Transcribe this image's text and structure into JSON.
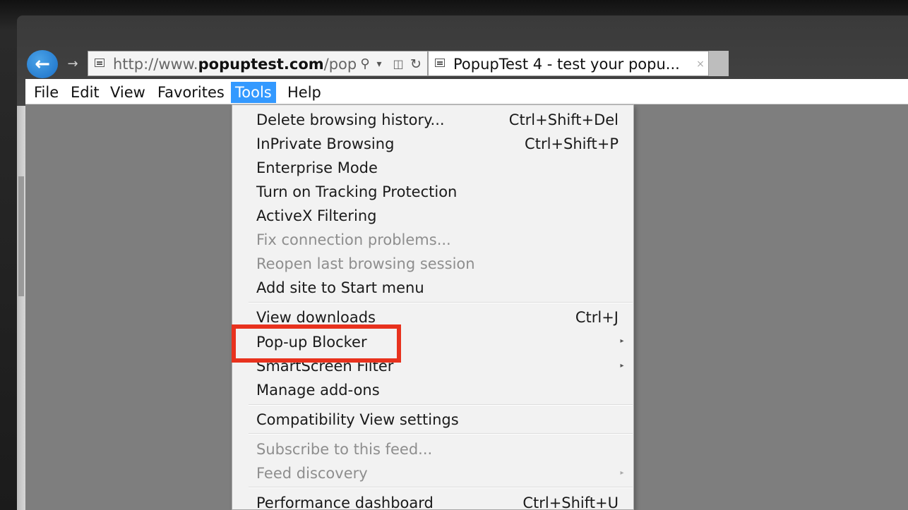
{
  "browser": {
    "address": {
      "prefix": "http://www.",
      "domain": "popuptest.com",
      "suffix": "/popu",
      "search_icon": "search-icon",
      "refresh_icon": "refresh-icon"
    },
    "tab": {
      "title": "PopupTest 4 - test your popu...",
      "close_symbol": "×"
    }
  },
  "menubar": {
    "items": [
      "File",
      "Edit",
      "View",
      "Favorites",
      "Tools",
      "Help"
    ],
    "active": "Tools"
  },
  "tools_menu": {
    "items": [
      {
        "label": "Delete browsing history...",
        "shortcut": "Ctrl+Shift+Del",
        "enabled": true
      },
      {
        "label": "InPrivate Browsing",
        "shortcut": "Ctrl+Shift+P",
        "enabled": true
      },
      {
        "label": "Enterprise Mode",
        "shortcut": "",
        "enabled": true
      },
      {
        "label": "Turn on Tracking Protection",
        "shortcut": "",
        "enabled": true
      },
      {
        "label": "ActiveX Filtering",
        "shortcut": "",
        "enabled": true
      },
      {
        "label": "Fix connection problems...",
        "shortcut": "",
        "enabled": false
      },
      {
        "label": "Reopen last browsing session",
        "shortcut": "",
        "enabled": false
      },
      {
        "label": "Add site to Start menu",
        "shortcut": "",
        "enabled": true
      },
      {
        "label": "View downloads",
        "shortcut": "Ctrl+J",
        "enabled": true
      },
      {
        "label": "Pop-up Blocker",
        "shortcut": "",
        "enabled": true,
        "submenu": true,
        "highlighted": true
      },
      {
        "label": "SmartScreen Filter",
        "shortcut": "",
        "enabled": true,
        "submenu": true
      },
      {
        "label": "Manage add-ons",
        "shortcut": "",
        "enabled": true
      },
      {
        "label": "Compatibility View settings",
        "shortcut": "",
        "enabled": true
      },
      {
        "label": "Subscribe to this feed...",
        "shortcut": "",
        "enabled": false
      },
      {
        "label": "Feed discovery",
        "shortcut": "",
        "enabled": false,
        "submenu": true
      },
      {
        "label": "Performance dashboard",
        "shortcut": "Ctrl+Shift+U",
        "enabled": true
      }
    ]
  },
  "colors": {
    "highlight_border": "#e8321e",
    "menu_active": "#3399ff",
    "back_button": "#1a6fc7"
  }
}
